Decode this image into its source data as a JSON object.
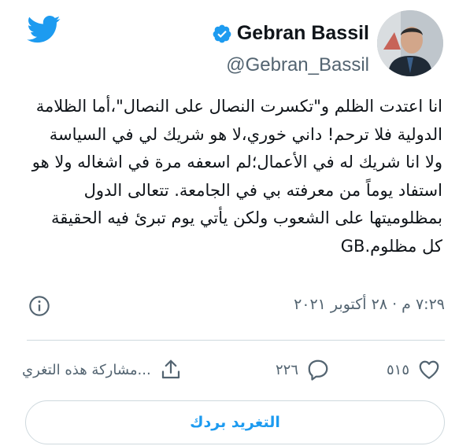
{
  "author": {
    "name": "Gebran Bassil",
    "handle": "@Gebran_Bassil"
  },
  "tweet": {
    "text": "انا اعتدت الظلم و\"تكسرت النصال على النصال\"،أما الظلامة الدولية فلا ترحم! داني خوري،لا هو شريك لي في السياسة ولا انا شريك له في الأعمال؛لم اسعفه مرة في اشغاله ولا هو استفاد يوماً من معرفته بي في الجامعة. تتعالى الدول بمظلوميتها على الشعوب ولكن يأتي يوم تبرئ فيه الحقيقة كل مظلوم.GB",
    "timestamp": "٧:٢٩ م · ٢٨ أكتوبر ٢٠٢١"
  },
  "actions": {
    "likes": "٥١٥",
    "replies": "٢٢٦",
    "share_label": "مشاركة هذه التغري..."
  },
  "reply_button": {
    "label": "التغريد بردك"
  },
  "icons": {
    "brand": "twitter-bird-icon",
    "verified": "verified-badge-icon",
    "info": "info-icon",
    "like": "heart-icon",
    "reply": "reply-bubble-icon",
    "share": "share-upload-icon"
  },
  "colors": {
    "brand_blue": "#1d9bf0",
    "text": "#0f1419",
    "muted": "#536471",
    "border": "#cfd9de"
  }
}
